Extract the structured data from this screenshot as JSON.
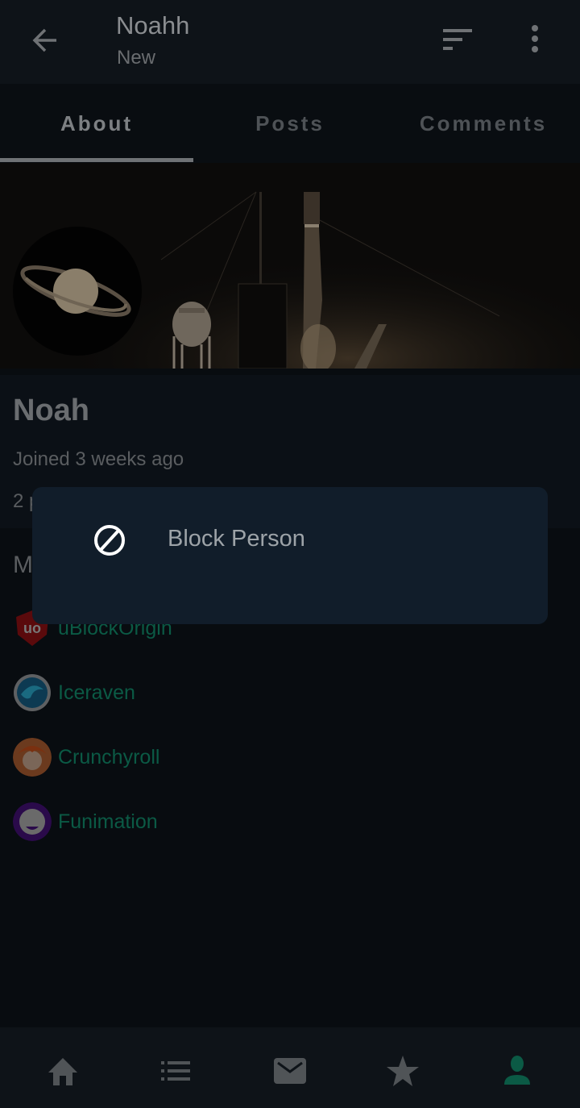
{
  "appbar": {
    "title": "Noahh",
    "subtitle": "New",
    "back_icon": "arrow-left-icon",
    "sort_icon": "sort-icon",
    "more_icon": "more-vertical-icon"
  },
  "tabs": [
    {
      "label": "About",
      "active": true
    },
    {
      "label": "Posts",
      "active": false
    },
    {
      "label": "Comments",
      "active": false
    }
  ],
  "profile": {
    "display_name": "Noah",
    "joined": "Joined 3 weeks ago",
    "stats_partial": "2 p",
    "section_partial": "M"
  },
  "communities": [
    {
      "name": "uBlockOrigin",
      "icon": "ublock-origin-icon"
    },
    {
      "name": "Iceraven",
      "icon": "iceraven-icon"
    },
    {
      "name": "Crunchyroll",
      "icon": "crunchyroll-icon"
    },
    {
      "name": "Funimation",
      "icon": "funimation-icon"
    }
  ],
  "dialog": {
    "items": [
      {
        "label": "Block Person",
        "icon": "block-icon"
      }
    ]
  },
  "bottom_nav": [
    {
      "name": "home",
      "icon": "home-icon",
      "active": false
    },
    {
      "name": "list",
      "icon": "list-icon",
      "active": false
    },
    {
      "name": "inbox",
      "icon": "mail-icon",
      "active": false
    },
    {
      "name": "saved",
      "icon": "star-icon",
      "active": false
    },
    {
      "name": "profile",
      "icon": "person-icon",
      "active": true
    }
  ],
  "colors": {
    "accent": "#0b5a45",
    "dialog_bg": "#111d2a",
    "appbar_bg": "#0e1318"
  }
}
